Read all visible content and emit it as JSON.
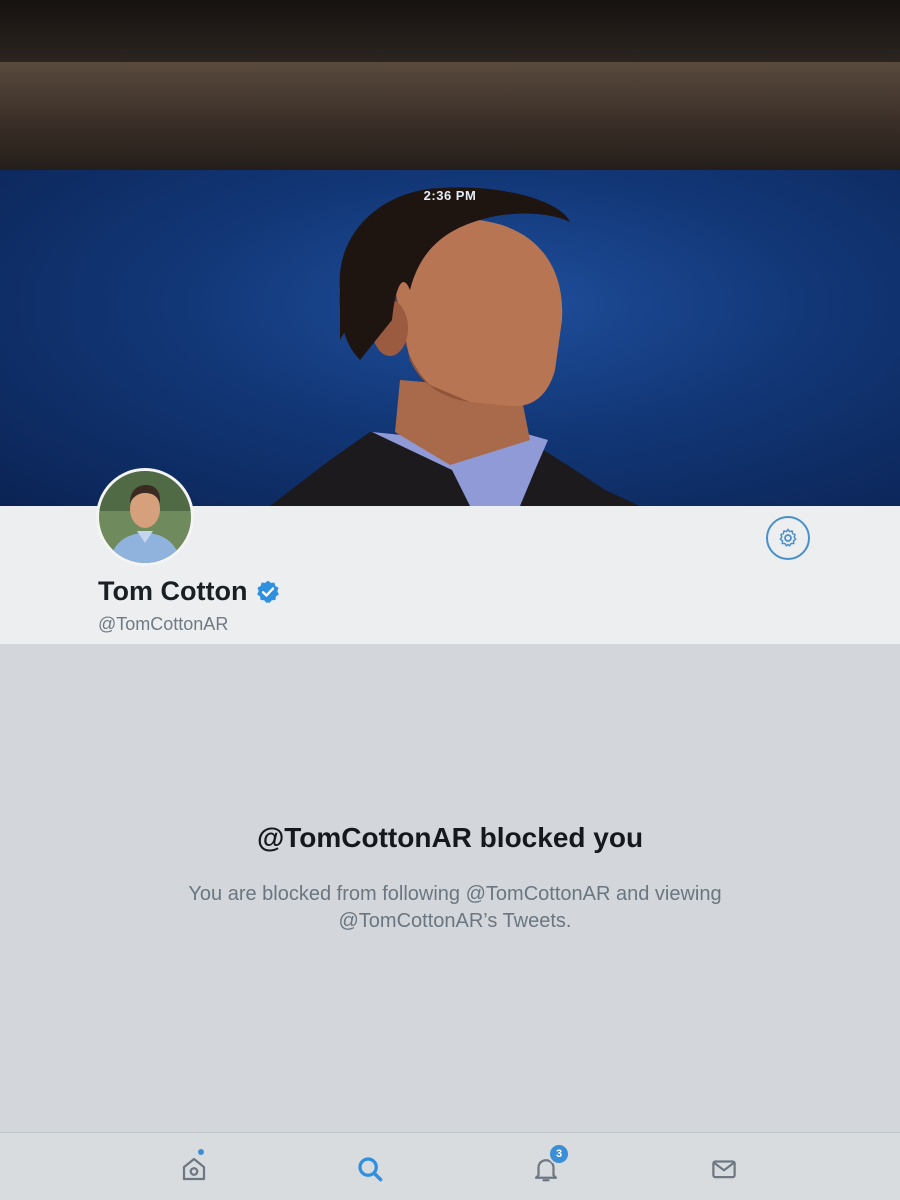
{
  "status_bar": {
    "time": "2:36 PM"
  },
  "profile": {
    "display_name": "Tom Cotton",
    "handle": "@TomCottonAR",
    "verified": true
  },
  "blocked": {
    "title": "@TomCottonAR blocked you",
    "description_line1": "You are blocked from following @TomCottonAR and viewing",
    "description_line2": "@TomCottonAR’s Tweets."
  },
  "tabbar": {
    "items": [
      {
        "icon": "home-icon",
        "has_dot": true
      },
      {
        "icon": "search-icon",
        "active": true
      },
      {
        "icon": "bell-icon",
        "badge": "3"
      },
      {
        "icon": "mail-icon"
      }
    ]
  },
  "colors": {
    "accent": "#3a8fd6",
    "banner_blue": "#123777",
    "panel": "#eceef0",
    "content_bg": "#d3d7db"
  }
}
